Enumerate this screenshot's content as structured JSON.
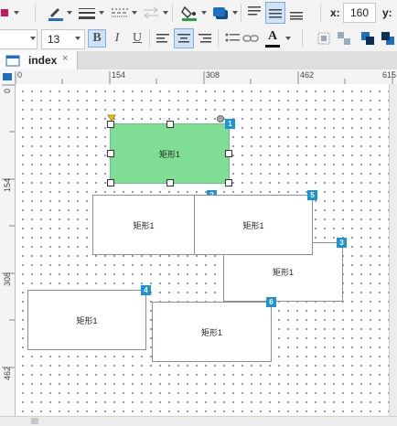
{
  "toolbar": {
    "x_label": "x:",
    "x_value": "160",
    "y_label": "y:",
    "font_size": "13",
    "bold_label": "B",
    "italic_label": "I",
    "underline_label": "U",
    "font_color_label": "A",
    "colors": {
      "fill": "#2ea043",
      "border": "#1f6fbf",
      "font_color": "#111111",
      "accent": "#1d93d3"
    }
  },
  "tabs": [
    {
      "label": "index",
      "close": "×"
    }
  ],
  "ruler": {
    "h_ticks": [
      "0",
      "154",
      "308",
      "462",
      "615"
    ],
    "v_ticks": [
      "0",
      "154",
      "308",
      "462"
    ]
  },
  "shapes": [
    {
      "id": "1",
      "label": "矩形1",
      "selected": true
    },
    {
      "id": "2",
      "label": "矩形1"
    },
    {
      "id": "5",
      "label": "矩形1"
    },
    {
      "id": "3",
      "label": "矩形1"
    },
    {
      "id": "4",
      "label": "矩形1"
    },
    {
      "id": "6",
      "label": "矩形1"
    }
  ]
}
